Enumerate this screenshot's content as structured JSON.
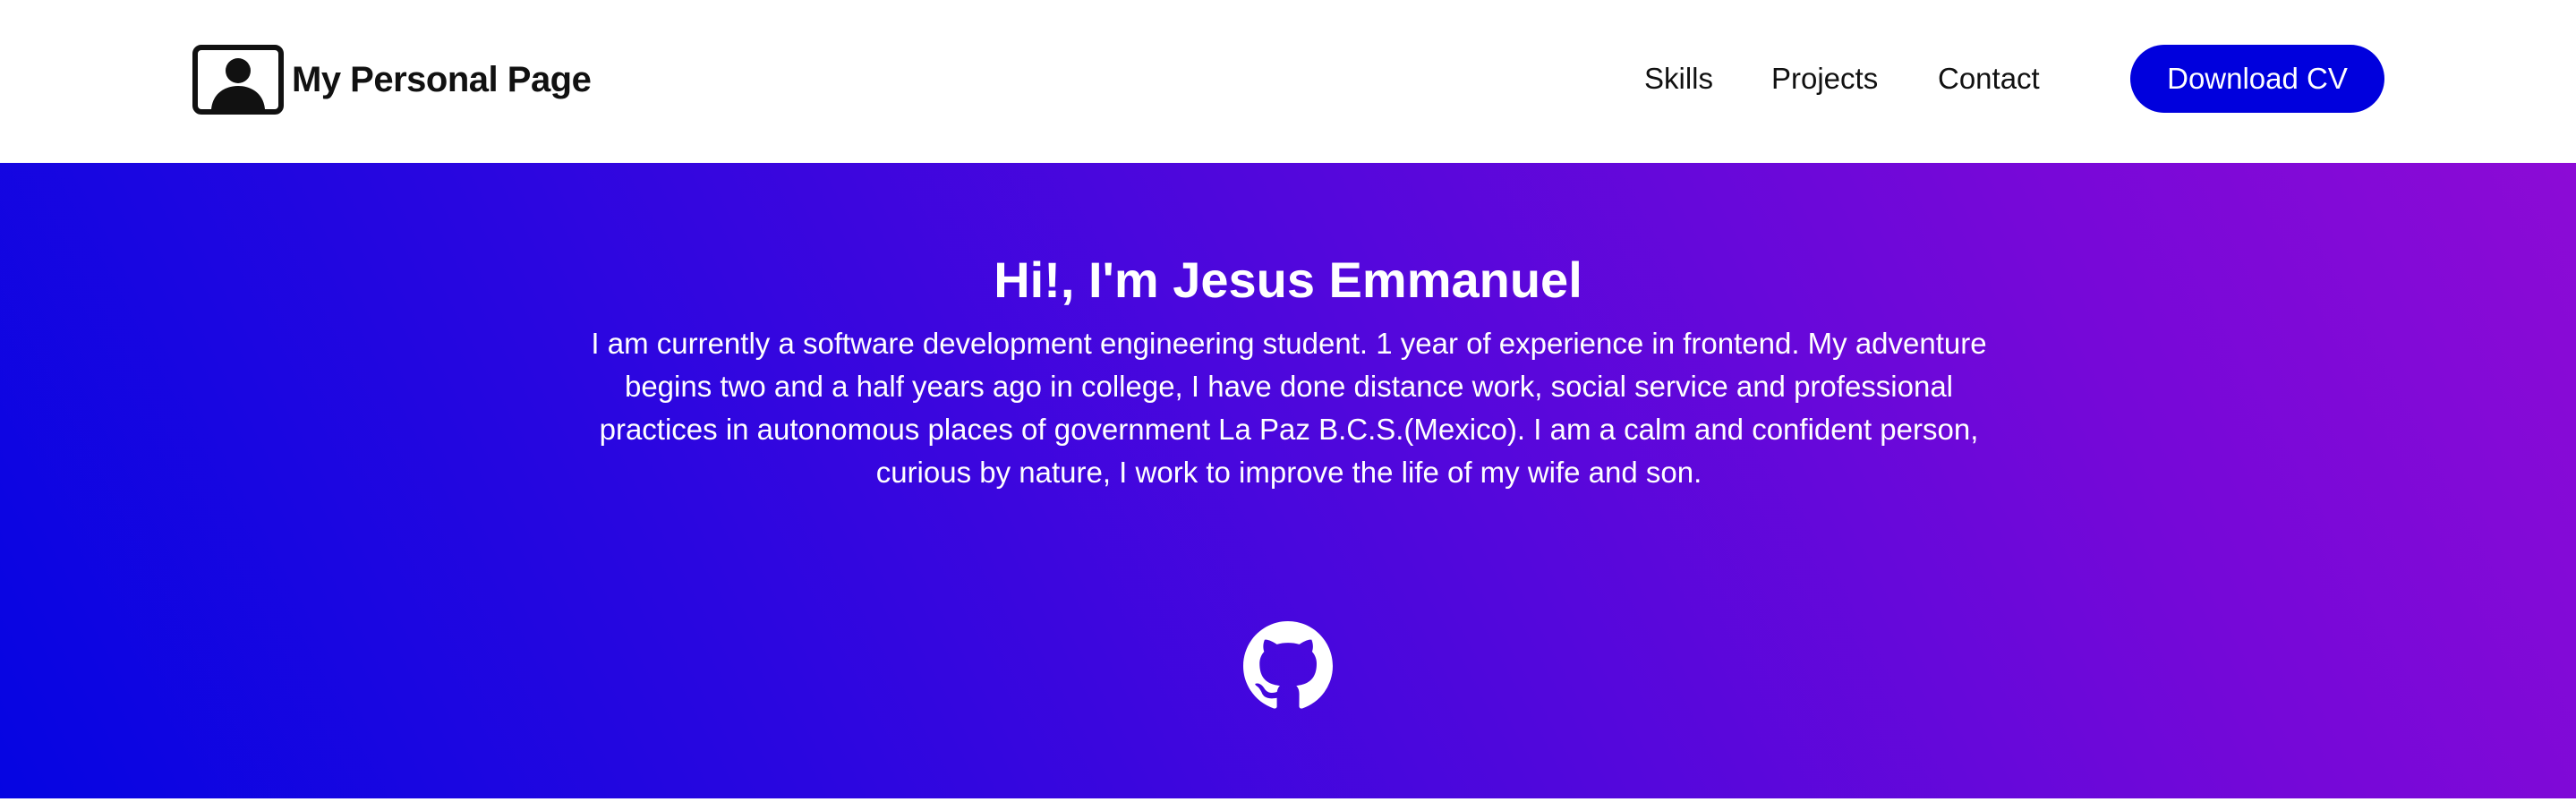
{
  "header": {
    "brand_title": "My Personal Page",
    "brand_icon": "portrait-icon",
    "nav": {
      "skills": "Skills",
      "projects": "Projects",
      "contact": "Contact"
    },
    "cv_button": "Download CV"
  },
  "hero": {
    "title": "Hi!, I'm Jesus Emmanuel",
    "description": "I am currently a software development engineering student. 1 year of experience in frontend. My adventure begins two and a half years ago in college, I have done distance work, social service and professional practices in autonomous places of government La Paz B.C.S.(Mexico). I am a calm and confident person, curious by nature, I work to improve the life of my wife and son.",
    "social_icon": "github-icon"
  },
  "colors": {
    "accent": "#0000dd",
    "hero_gradient_start": "#0505e2",
    "hero_gradient_end": "#8c0bd6",
    "text_dark": "#111111",
    "text_light": "#ffffff"
  }
}
